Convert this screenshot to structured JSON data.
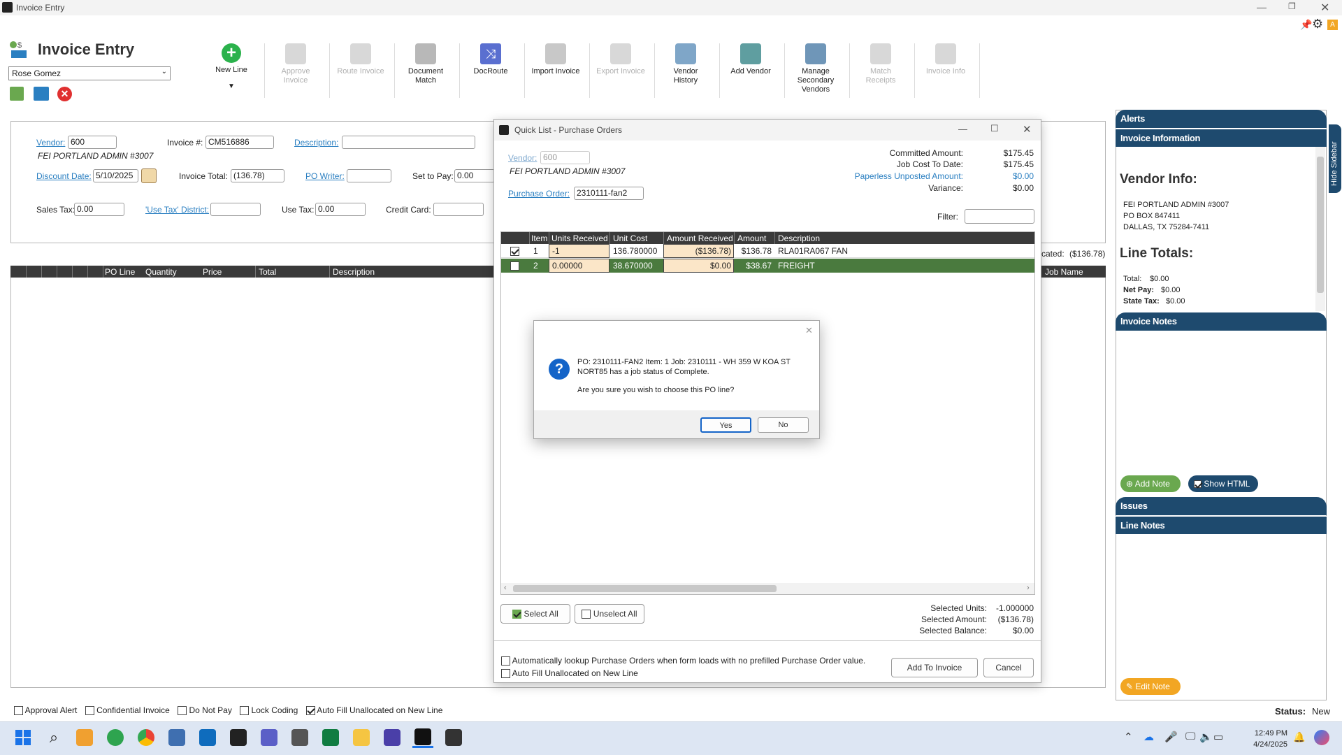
{
  "window": {
    "title": "Invoice Entry"
  },
  "header": {
    "title": "Invoice Entry",
    "user": "Rose Gomez"
  },
  "toolbar": [
    {
      "label": "New Line",
      "enabled": true
    },
    {
      "label": "Approve Invoice",
      "enabled": false
    },
    {
      "label": "Route Invoice",
      "enabled": false
    },
    {
      "label": "Document Match",
      "enabled": true
    },
    {
      "label": "DocRoute",
      "enabled": true
    },
    {
      "label": "Import Invoice",
      "enabled": true
    },
    {
      "label": "Export Invoice",
      "enabled": false
    },
    {
      "label": "Vendor History",
      "enabled": true
    },
    {
      "label": "Add Vendor",
      "enabled": true
    },
    {
      "label": "Manage Secondary Vendors",
      "enabled": true
    },
    {
      "label": "Match Receipts",
      "enabled": false
    },
    {
      "label": "Invoice Info",
      "enabled": false
    }
  ],
  "form": {
    "vendor_label": "Vendor:",
    "vendor_value": "600",
    "vendor_name": "FEI PORTLAND ADMIN #3007",
    "invoice_no_label": "Invoice #:",
    "invoice_no_value": "CM516886",
    "description_label": "Description:",
    "description_value": "",
    "discount_date_label": "Discount Date:",
    "discount_date_value": "5/10/2025",
    "invoice_total_label": "Invoice Total:",
    "invoice_total_value": "(136.78)",
    "po_writer_label": "PO Writer:",
    "po_writer_value": "",
    "set_to_pay_label": "Set to Pay:",
    "set_to_pay_value": "0.00",
    "sales_tax_label": "Sales Tax:",
    "sales_tax_value": "0.00",
    "use_tax_district_label": "'Use Tax' District:",
    "use_tax_district_value": "",
    "use_tax_label": "Use Tax:",
    "use_tax_value": "0.00",
    "credit_card_label": "Credit Card:",
    "credit_card_value": "",
    "allocated_label": "cated:",
    "allocated_value": "($136.78)"
  },
  "grid": {
    "columns": [
      "PO Line",
      "Quantity",
      "Price",
      "Total",
      "Description"
    ],
    "job_name": "Job Name"
  },
  "bottom_options": {
    "items": [
      {
        "label": "Approval Alert",
        "checked": false
      },
      {
        "label": "Confidential Invoice",
        "checked": false
      },
      {
        "label": "Do Not Pay",
        "checked": false
      },
      {
        "label": "Lock Coding",
        "checked": false
      },
      {
        "label": "Auto Fill Unallocated on New Line",
        "checked": true
      }
    ],
    "status_label": "Status:",
    "status_value": "New"
  },
  "sidebar": {
    "hide_label": "Hide Sidebar",
    "alerts": "Alerts",
    "invoice_information": "Invoice Information",
    "vendor_info_title": "Vendor Info:",
    "vendor_lines": [
      "FEI PORTLAND ADMIN #3007",
      "PO BOX 847411",
      "DALLAS, TX 75284-7411"
    ],
    "line_totals_title": "Line Totals:",
    "total_label": "Total:",
    "total_value": "$0.00",
    "net_pay_label": "Net Pay:",
    "net_pay_value": "$0.00",
    "state_tax_label": "State Tax:",
    "state_tax_value": "$0.00",
    "invoice_notes": "Invoice Notes",
    "add_note": "Add Note",
    "show_html": "Show HTML",
    "issues": "Issues",
    "line_notes": "Line Notes",
    "edit_note": "Edit Note"
  },
  "quicklist": {
    "title": "Quick List - Purchase Orders",
    "vendor_label": "Vendor:",
    "vendor_value": "600",
    "vendor_name": "FEI PORTLAND ADMIN #3007",
    "po_label": "Purchase Order:",
    "po_value": "2310111-fan2",
    "committed_label": "Committed Amount:",
    "committed_value": "$175.45",
    "job_cost_label": "Job Cost To Date:",
    "job_cost_value": "$175.45",
    "paperless_label": "Paperless Unposted Amount:",
    "paperless_value": "$0.00",
    "variance_label": "Variance:",
    "variance_value": "$0.00",
    "filter_label": "Filter:",
    "columns": [
      "Item",
      "Units Received",
      "Unit Cost",
      "Amount Received",
      "Amount",
      "Description"
    ],
    "rows": [
      {
        "checked": true,
        "item": "1",
        "units": "-1",
        "unit_cost": "136.780000",
        "amount_received": "($136.78)",
        "amount": "$136.78",
        "description": "RLA01RA067 FAN"
      },
      {
        "checked": false,
        "item": "2",
        "units": "0.00000",
        "unit_cost": "38.670000",
        "amount_received": "$0.00",
        "amount": "$38.67",
        "description": "FREIGHT"
      }
    ],
    "select_all": "Select All",
    "unselect_all": "Unselect All",
    "selected_units_label": "Selected Units:",
    "selected_units_value": "-1.000000",
    "selected_amount_label": "Selected Amount:",
    "selected_amount_value": "($136.78)",
    "selected_balance_label": "Selected Balance:",
    "selected_balance_value": "$0.00",
    "auto_lookup": "Automatically lookup Purchase Orders when form loads with no prefilled Purchase Order value.",
    "auto_fill": "Auto Fill Unallocated on New Line",
    "add_to_invoice": "Add To Invoice",
    "cancel": "Cancel"
  },
  "dialog": {
    "line1": "PO:  2310111-FAN2  Item:  1  Job: 2310111 - WH 359 W KOA ST",
    "line2": "NORT85 has a job status of Complete.",
    "line3": "Are you sure you wish to choose this PO line?",
    "yes": "Yes",
    "no": "No"
  },
  "taskbar": {
    "time": "12:49 PM",
    "date": "4/24/2025"
  },
  "colors": {
    "sidebar_header": "#1e4a6e",
    "selected_row": "#4a7a3e",
    "link": "#2a7fc1",
    "grid_header": "#3a3a3a",
    "edit_note": "#f2a623",
    "add_note": "#6aa84f"
  }
}
